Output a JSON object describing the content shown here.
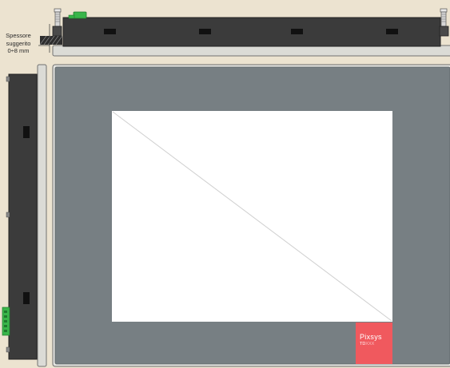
{
  "thickness_note": {
    "line1": "Spessore",
    "line2": "suggerito",
    "line3": "0÷8 mm"
  },
  "logo": {
    "brand": "Pixsys",
    "model_prefix": "TD",
    "model_suffix": "XXX"
  },
  "colors": {
    "background": "#ece3d0",
    "housing": "#3b3b3b",
    "panel_gray": "#777f83",
    "screen": "#ffffff",
    "badge": "#f0595e",
    "connector": "#39b54a"
  },
  "icons": {
    "mount_screw_left": "screw-icon",
    "mount_screw_right": "screw-icon",
    "connector": "terminal-connector-icon"
  }
}
